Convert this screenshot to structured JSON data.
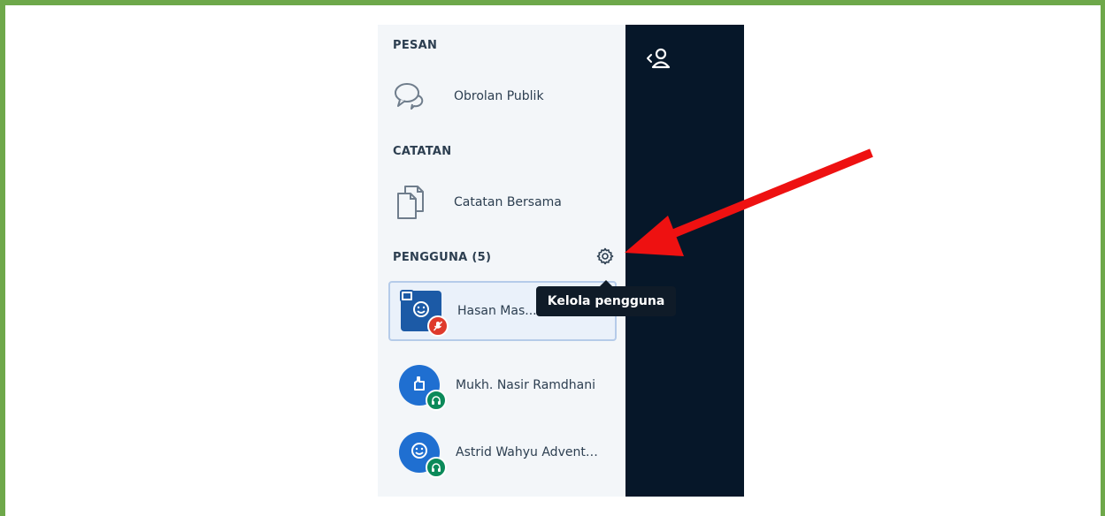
{
  "sidebar": {
    "messages_title": "PESAN",
    "public_chat_label": "Obrolan Publik",
    "notes_title": "CATATAN",
    "shared_notes_label": "Catatan Bersama",
    "users_title": "PENGGUNA (5)",
    "users": [
      {
        "name": "Hasan Mas... (Anda)",
        "avatar_icon": "smiley-icon",
        "badge_icon": "muted-mic-icon",
        "badge_color": "#df3a2c",
        "presenter": true,
        "selected": true
      },
      {
        "name": "Mukh. Nasir Ramdhani",
        "avatar_icon": "thumbs-up-icon",
        "badge_icon": "headphones-icon",
        "badge_color": "#0b8a5a",
        "presenter": false,
        "selected": false
      },
      {
        "name": "Astrid Wahyu Advent…",
        "avatar_icon": "smiley-icon",
        "badge_icon": "headphones-icon",
        "badge_color": "#0b8a5a",
        "presenter": false,
        "selected": false
      }
    ]
  },
  "tooltip": {
    "text": "Kelola pengguna"
  },
  "colors": {
    "frame": "#6ea84a",
    "dark_bar": "#061729",
    "panel": "#f3f6f9",
    "arrow": "#ee1111",
    "accent": "#1f6fd1"
  }
}
